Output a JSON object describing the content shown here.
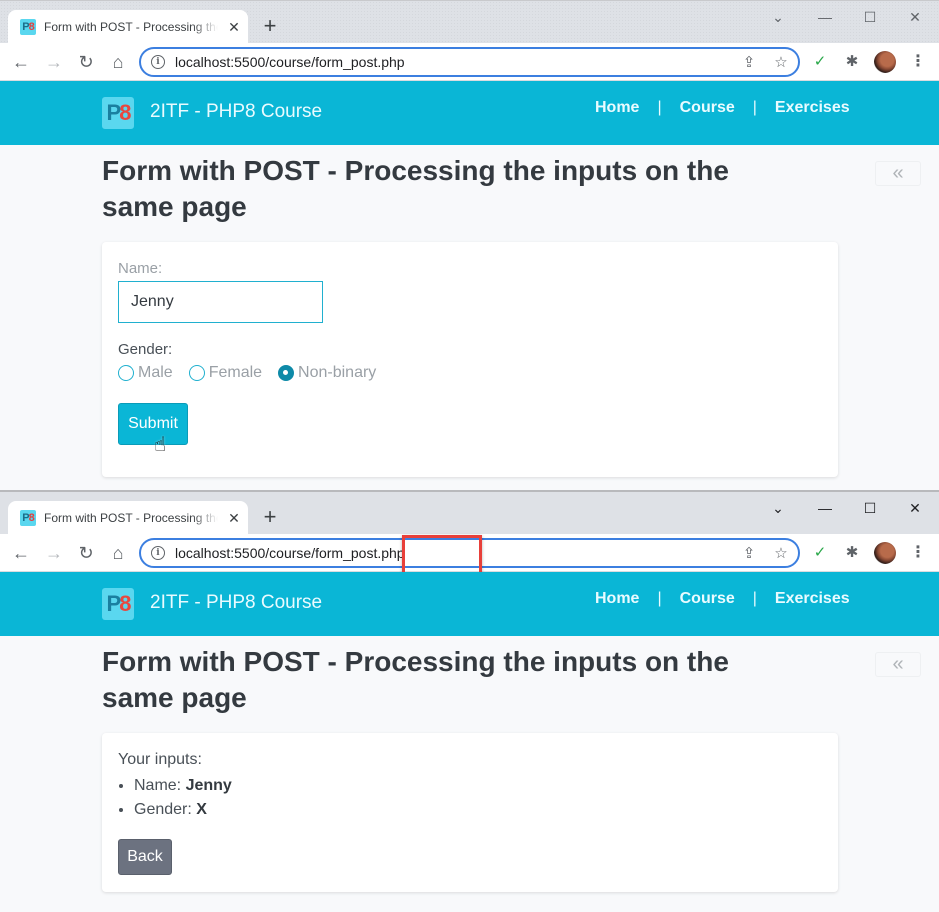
{
  "browser": {
    "tab_title": "Form with POST - Processing the inputs on the same page",
    "favicon_text_p": "P",
    "favicon_text_8": "8",
    "tab_close": "✕",
    "new_tab": "+",
    "url": "localhost:5500/course/form_post.php",
    "controls": {
      "tab_search": "⌄",
      "minimize": "—",
      "maximize": "☐",
      "close": "✕"
    },
    "nav": {
      "back": "←",
      "forward": "→",
      "reload": "↻",
      "home": "⌂"
    },
    "omnibox_icons": {
      "info": "i",
      "share": "⇪",
      "bookmark": "☆"
    },
    "extensions": {
      "ext1": "✓",
      "puzzle": "✱",
      "menu": "⋮"
    }
  },
  "site": {
    "logo_p": "P",
    "logo_8": "8",
    "brand": "2ITF - PHP8 Course",
    "nav": [
      {
        "label": "Home"
      },
      {
        "label": "Course"
      },
      {
        "label": "Exercises"
      }
    ],
    "separator": "|",
    "page_title": "Form with POST - Processing the inputs on the same page",
    "collapse_icon": "«"
  },
  "form": {
    "name_label": "Name:",
    "name_value": "Jenny",
    "gender_label": "Gender:",
    "gender_options": [
      {
        "label": "Male",
        "checked": false
      },
      {
        "label": "Female",
        "checked": false
      },
      {
        "label": "Non-binary",
        "checked": true
      }
    ],
    "submit_label": "Submit"
  },
  "result": {
    "title": "Your inputs:",
    "items": [
      {
        "label": "Name: ",
        "value": "Jenny"
      },
      {
        "label": "Gender: ",
        "value": "X"
      }
    ],
    "back_label": "Back"
  },
  "colors": {
    "header": "#0ab6d6",
    "highlight": "#e8403a",
    "back_button": "#6c7280"
  }
}
